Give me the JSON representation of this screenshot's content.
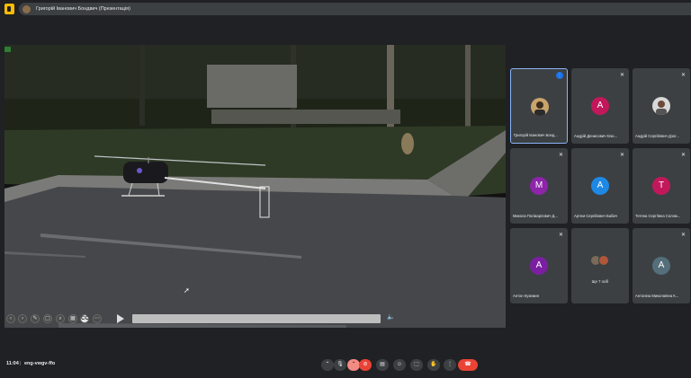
{
  "topbar": {
    "presenter_label": "Григорій Іванович Бондвич (Презентація)"
  },
  "stage": {
    "player": {
      "cc_label": "CC",
      "more_label": "⋯"
    }
  },
  "participants": [
    {
      "name": "Григорій Іванович Бонд...",
      "type": "photo",
      "active": true
    },
    {
      "name": "Андрій Денисович Клю...",
      "type": "letter",
      "letter": "A",
      "color": "#c2185b"
    },
    {
      "name": "Андрій Сергійович Дзог...",
      "type": "photo"
    },
    {
      "name": "Микола Полікарпович Д...",
      "type": "letter",
      "letter": "M",
      "color": "#8e24aa"
    },
    {
      "name": "Артем Сергійович Бабич",
      "type": "letter",
      "letter": "A",
      "color": "#1e88e5"
    },
    {
      "name": "Тетяна Сергіївна Солом...",
      "type": "letter",
      "letter": "T",
      "color": "#c2185b"
    },
    {
      "name": "Антон Куземин",
      "type": "letter",
      "letter": "A",
      "color": "#7b1fa2"
    },
    {
      "name": "Ще 7 осіб",
      "type": "group"
    },
    {
      "name": "Антоніна Миколаївна К...",
      "type": "letter",
      "letter": "A",
      "color": "#546e7a"
    }
  ],
  "bottombar": {
    "time": "11:04",
    "separator": "|",
    "meeting_code": "eng-vwgv-ffo"
  },
  "colors": {
    "accent": "#8ab4f8",
    "hangup": "#ea4335"
  }
}
